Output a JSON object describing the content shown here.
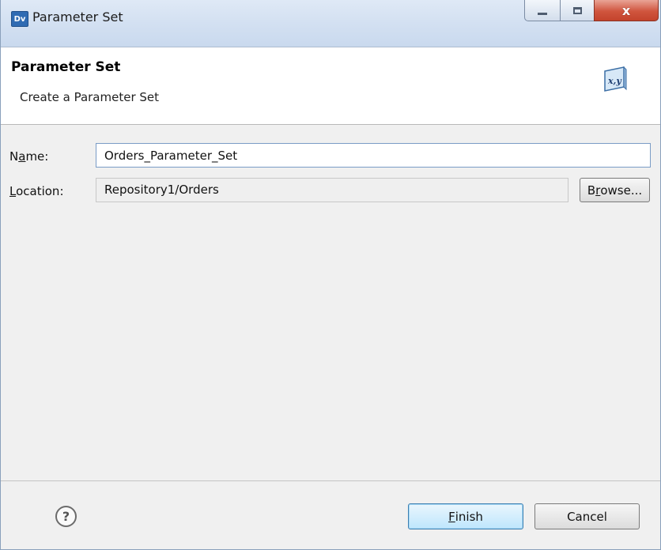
{
  "window": {
    "app_icon_text": "Dv",
    "title": "Parameter Set",
    "controls": {
      "minimize": "",
      "maximize": "",
      "close": "x"
    }
  },
  "header": {
    "title": "Parameter Set",
    "description": "Create a Parameter Set",
    "icon": "x,y"
  },
  "form": {
    "name": {
      "label_mnemonic": "a",
      "label_pre": "N",
      "label_post": "me:",
      "value": "Orders_Parameter_Set"
    },
    "location": {
      "label_mnemonic": "L",
      "label_post": "ocation:",
      "value": "Repository1/Orders"
    },
    "browse_button": {
      "pre": "B",
      "mnemonic": "r",
      "post": "owse..."
    }
  },
  "footer": {
    "help_icon": "?",
    "finish_button": {
      "mnemonic": "F",
      "post": "inish"
    },
    "cancel_button": "Cancel"
  }
}
